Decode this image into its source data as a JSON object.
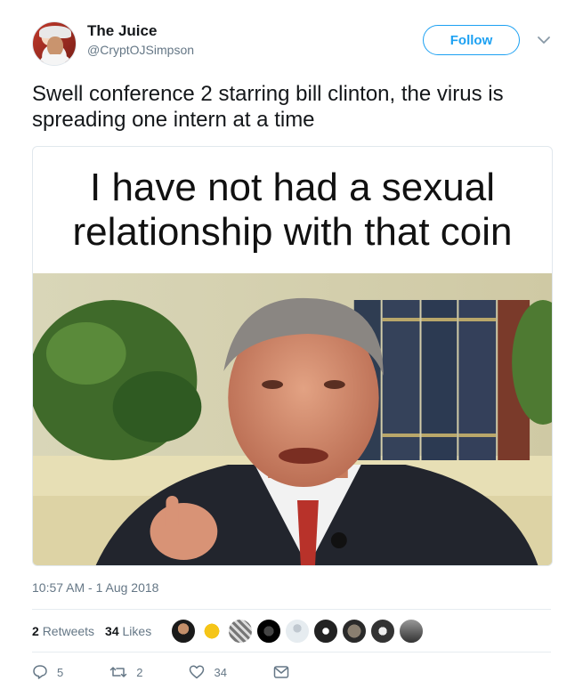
{
  "user": {
    "display_name": "The Juice",
    "handle": "@CryptOJSimpson",
    "follow_label": "Follow"
  },
  "tweet": {
    "text": "Swell conference 2  starring bill clinton, the virus is spreading one intern at a time",
    "timestamp": "10:57 AM - 1 Aug 2018"
  },
  "media": {
    "caption": "I have not had a sexual relationship with that coin"
  },
  "stats": {
    "retweets_count": "2",
    "retweets_label": "Retweets",
    "likes_count": "34",
    "likes_label": "Likes"
  },
  "actions": {
    "reply_count": "5",
    "retweet_count": "2",
    "like_count": "34"
  },
  "colors": {
    "accent": "#1da1f2",
    "text_secondary": "#657786",
    "divider": "#e6ecf0"
  },
  "icons": [
    "chevron-down-icon",
    "reply-icon",
    "retweet-icon",
    "heart-icon",
    "message-icon"
  ]
}
